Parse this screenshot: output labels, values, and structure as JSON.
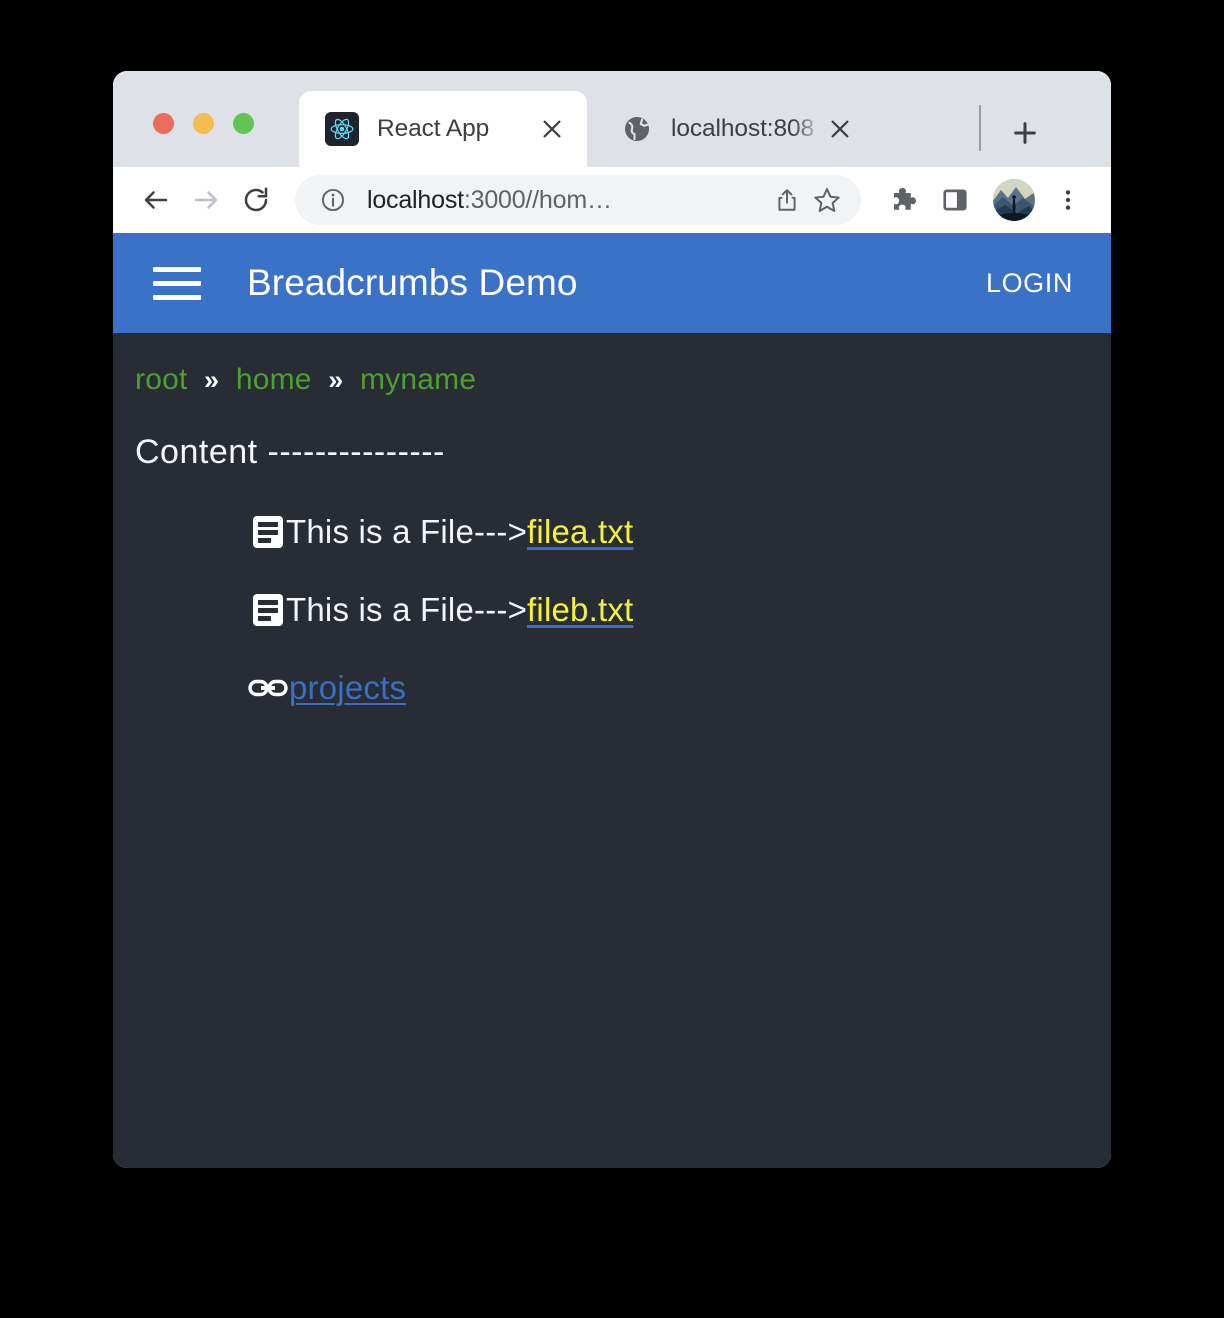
{
  "window": {
    "traffic_lights": [
      {
        "name": "close",
        "color": "#ed6a5e"
      },
      {
        "name": "minimize",
        "color": "#f4bd4f"
      },
      {
        "name": "maximize",
        "color": "#61c454"
      }
    ]
  },
  "browser": {
    "tabs": [
      {
        "title": "React App",
        "icon": "react-logo-icon",
        "active": true
      },
      {
        "title": "localhost:808",
        "icon": "globe-icon",
        "active": false
      }
    ],
    "new_tab_label": "+",
    "tab_list_chevron": "⌄",
    "toolbar": {
      "back_label": "←",
      "forward_label": "→",
      "reload_label": "↻",
      "url_host": "localhost",
      "url_path": ":3000//hom…",
      "share_icon": "share-icon",
      "bookmark_icon": "star-icon",
      "extensions_icon": "puzzle-icon",
      "side_panel_icon": "side-panel-icon",
      "avatar_icon": "profile-avatar",
      "menu_icon": "three-dot-menu-icon"
    }
  },
  "app": {
    "appbar": {
      "menu_icon": "hamburger-menu-icon",
      "title": "Breadcrumbs Demo",
      "login_label": "LOGIN"
    },
    "breadcrumbs": {
      "separator": "»",
      "items": [
        {
          "label": "root"
        },
        {
          "label": "home"
        },
        {
          "label": "myname"
        }
      ]
    },
    "content_heading": "Content ---------------",
    "rows": [
      {
        "icon": "file-icon",
        "label": "This is a File--->",
        "link": "filea.txt",
        "link_type": "file"
      },
      {
        "icon": "file-icon",
        "label": "This is a File--->",
        "link": "fileb.txt",
        "link_type": "file"
      },
      {
        "icon": "link-icon",
        "label": "",
        "link": "projects",
        "link_type": "folder"
      }
    ]
  },
  "colors": {
    "appbar_blue": "#3a72c8",
    "page_background": "#282c34",
    "breadcrumb_green": "#4f9f2f",
    "file_link_yellow": "#f2f238",
    "page_link_blue": "#3a6fc4"
  }
}
